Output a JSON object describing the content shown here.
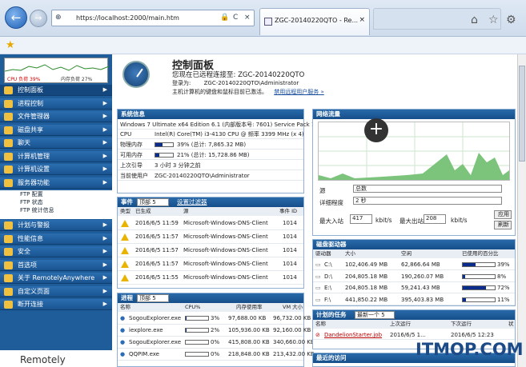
{
  "browser": {
    "url": "https://localhost:2000/main.htm",
    "tab_title": "ZGC-20140220QTO - Re...",
    "tab_close": "×",
    "back": "←",
    "forward": "→",
    "addr_icons": [
      "⊕",
      "🔒",
      "C",
      "×"
    ]
  },
  "sidebar": {
    "perf": {
      "cpu": "CPU 负荷 39%",
      "mem": "内存负荷 27%"
    },
    "items": [
      {
        "label": "控制面板",
        "selected": true
      },
      {
        "label": "进程控制"
      },
      {
        "label": "文件管理器"
      },
      {
        "label": "磁盘共享"
      },
      {
        "label": "聊天"
      },
      {
        "label": "计算机管理"
      },
      {
        "label": "计算机设置"
      },
      {
        "label": "服务器功能"
      }
    ],
    "subitems": [
      "FTP 配置",
      "FTP 状态",
      "FTP 统计信息"
    ],
    "items2": [
      {
        "label": "计划与警报"
      },
      {
        "label": "性能信息"
      },
      {
        "label": "安全"
      },
      {
        "label": "首选项"
      },
      {
        "label": "关于 RemotelyAnywhere"
      },
      {
        "label": "自定义页面"
      },
      {
        "label": "断开连接"
      }
    ],
    "logo": "Remotely"
  },
  "header": {
    "title": "控制面板",
    "line1": "您现在已远程连接至: ZGC-20140220QTO",
    "login_label": "登录为:",
    "login_value": "ZGC-20140220QTO\\Administrator",
    "line3": "主机计算机的键盘和鼠标目前已激活。",
    "link": "禁用远程用户服务 »"
  },
  "sysinfo": {
    "title": "系统信息",
    "os": "Windows 7 Ultimate x64 Edition 6.1 (内部版本号: 7601) Service Pack 1",
    "rows": [
      {
        "k": "CPU",
        "v": "Intel(R) Core(TM) i3-4130 CPU @ 频率 3399 MHz (x 4)"
      },
      {
        "k": "物理内存",
        "v": "39% (总计: 7,865.32 MB)",
        "pct": 39
      },
      {
        "k": "可用内存",
        "v": "21% (总计: 15,728.86 MB)",
        "pct": 21
      },
      {
        "k": "上次引导",
        "v": "3 小时 3 分钟之前"
      },
      {
        "k": "当前使用户",
        "v": "ZGC-20140220QTO\\Administrator"
      }
    ]
  },
  "events": {
    "title": "事件",
    "filter": "顶部 5",
    "filter_link": "设置过滤器",
    "cols": [
      "类型",
      "已生成",
      "源",
      "事件 ID"
    ],
    "rows": [
      {
        "time": "2016/6/5 11:59",
        "src": "Microsoft-Windows-DNS-Client",
        "id": "1014"
      },
      {
        "time": "2016/6/5 11:57",
        "src": "Microsoft-Windows-DNS-Client",
        "id": "1014"
      },
      {
        "time": "2016/6/5 11:57",
        "src": "Microsoft-Windows-DNS-Client",
        "id": "1014"
      },
      {
        "time": "2016/6/5 11:57",
        "src": "Microsoft-Windows-DNS-Client",
        "id": "1014"
      },
      {
        "time": "2016/6/5 11:55",
        "src": "Microsoft-Windows-DNS-Client",
        "id": "1014"
      }
    ]
  },
  "procs": {
    "title": "进程",
    "filter": "顶部 5",
    "cols": [
      "名称",
      "CPU%",
      "内存使用率",
      "VM 大小"
    ],
    "rows": [
      {
        "name": "SogouExplorer.exe",
        "cpu": "3%",
        "cpupct": 3,
        "mem": "97,688.00 KB",
        "vm": "96,732.00 KB"
      },
      {
        "name": "iexplore.exe",
        "cpu": "2%",
        "cpupct": 2,
        "mem": "105,936.00 KB",
        "vm": "92,160.00 KB"
      },
      {
        "name": "SogouExplorer.exe",
        "cpu": "0%",
        "cpupct": 0,
        "mem": "415,808.00 KB",
        "vm": "340,660.00 KB"
      },
      {
        "name": "QQPIM.exe",
        "cpu": "0%",
        "cpupct": 0,
        "mem": "218,848.00 KB",
        "vm": "213,432.00 KB"
      }
    ]
  },
  "network": {
    "title": "网络流量",
    "source_label": "源",
    "source_value": "总数",
    "interval_label": "详细程度",
    "interval_value": "2 秒",
    "max_in_label": "最大入站",
    "max_in_value": "417",
    "max_in_unit": "kbit/s",
    "max_out_label": "最大出站",
    "max_out_value": "208",
    "max_out_unit": "kbit/s",
    "apply": "应用",
    "refresh": "刷新"
  },
  "disks": {
    "title": "磁盘驱动器",
    "cols": [
      "驱动器",
      "大小",
      "空闲",
      "已使用的百分比"
    ],
    "rows": [
      {
        "d": "C:\\",
        "size": "102,406.49 MB",
        "free": "62,866.64 MB",
        "pct": 39
      },
      {
        "d": "D:\\",
        "size": "204,805.18 MB",
        "free": "190,260.07 MB",
        "pct": 8
      },
      {
        "d": "E:\\",
        "size": "204,805.18 MB",
        "free": "59,241.43 MB",
        "pct": 72
      },
      {
        "d": "F:\\",
        "size": "441,850.22 MB",
        "free": "395,403.83 MB",
        "pct": 11
      }
    ]
  },
  "tasks": {
    "title": "计划的任务",
    "filter": "最新一个 5",
    "cols": [
      "名称",
      "上次运行",
      "下次运行",
      "状"
    ],
    "row": {
      "name": "DandelionStarter.job",
      "last": "2016/6/5 1...",
      "next": "2016/6/5 12:23"
    }
  },
  "recent": {
    "title": "最近的访问"
  },
  "watermark": "ITMOP.COM"
}
